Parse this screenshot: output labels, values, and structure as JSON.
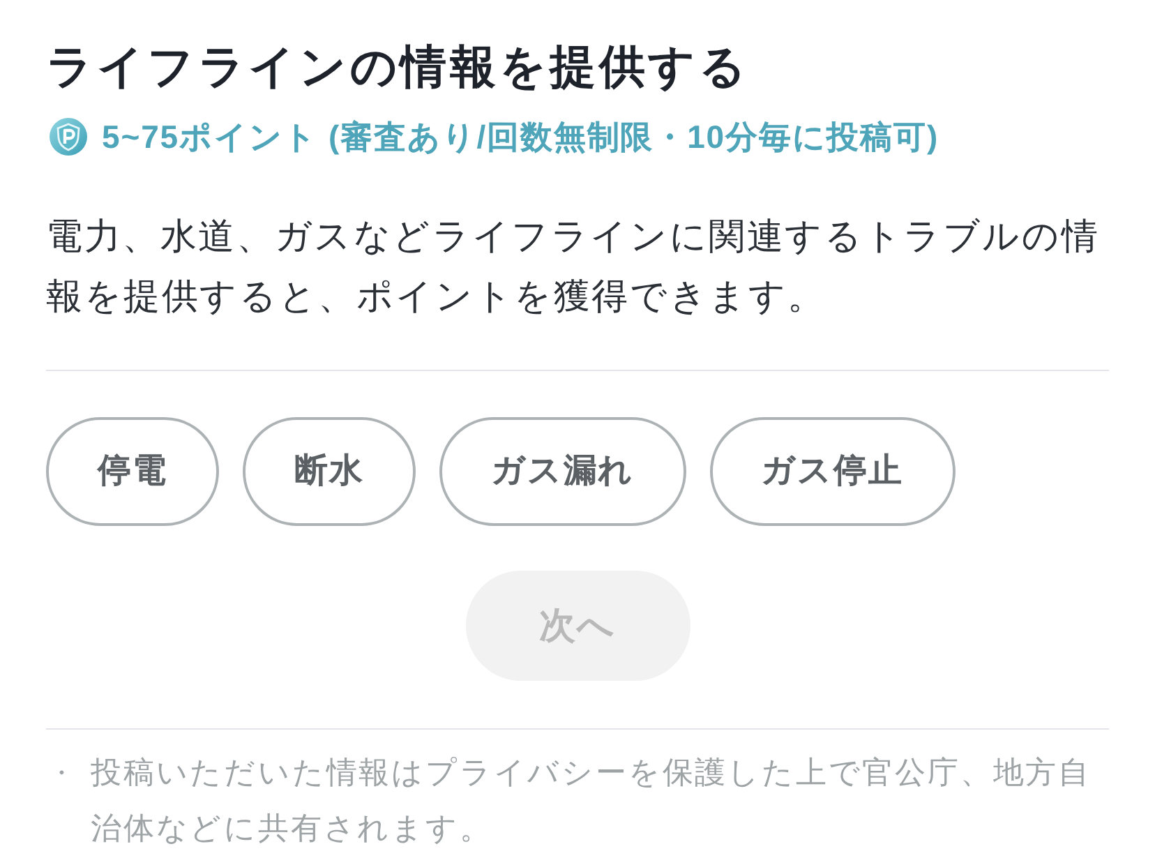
{
  "header": {
    "title": "ライフラインの情報を提供する",
    "points": "5~75ポイント (審査あり/回数無制限・10分毎に投稿可)"
  },
  "description": "電力、水道、ガスなどライフラインに関連するトラブルの情報を提供すると、ポイントを獲得できます。",
  "categories": [
    {
      "label": "停電",
      "selected": false
    },
    {
      "label": "断水",
      "selected": false
    },
    {
      "label": "ガス漏れ",
      "selected": false
    },
    {
      "label": "ガス停止",
      "selected": false
    }
  ],
  "next_button": {
    "label": "次へ",
    "disabled": true
  },
  "notes": [
    {
      "bullet": "・",
      "text": "投稿いただいた情報はプライバシーを保護した上で官公庁、地方自治体などに共有されます。"
    }
  ]
}
